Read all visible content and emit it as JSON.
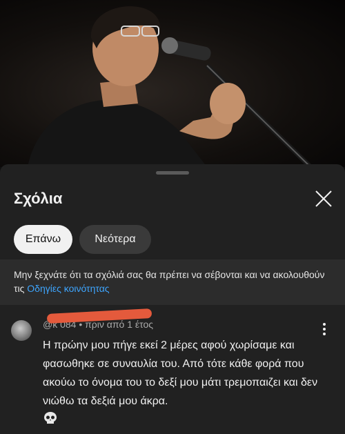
{
  "video": {
    "description_icon": "singer-with-microphone-image"
  },
  "sheet": {
    "title": "Σχόλια",
    "close_icon": "close-icon",
    "sort_chips": [
      {
        "label": "Επάνω",
        "selected": true
      },
      {
        "label": "Νεότερα",
        "selected": false
      }
    ],
    "notice": {
      "text": "Μην ξεχνάτε ότι τα σχόλιά σας θα πρέπει να σέβονται και να ακολουθούν τις ",
      "link": "Οδηγίες κοινότητας"
    }
  },
  "comment": {
    "author_visible": "@k                          084",
    "time": " • πριν από 1 έτος",
    "text": "Η πρώην μου πήγε εκεί 2 μέρες αφού χωρίσαμε και φασωθηκε σε συναυλία του. Από τότε κάθε φορά που ακούω το όνομα του το δεξί μου μάτι τρεμοπαιζει και δεν νιώθω τα δεξιά μου άκρα.",
    "emoji": "skull-emoji"
  },
  "colors": {
    "background": "#212121",
    "link": "#3ea6ff",
    "redaction": "#e45a3c"
  }
}
